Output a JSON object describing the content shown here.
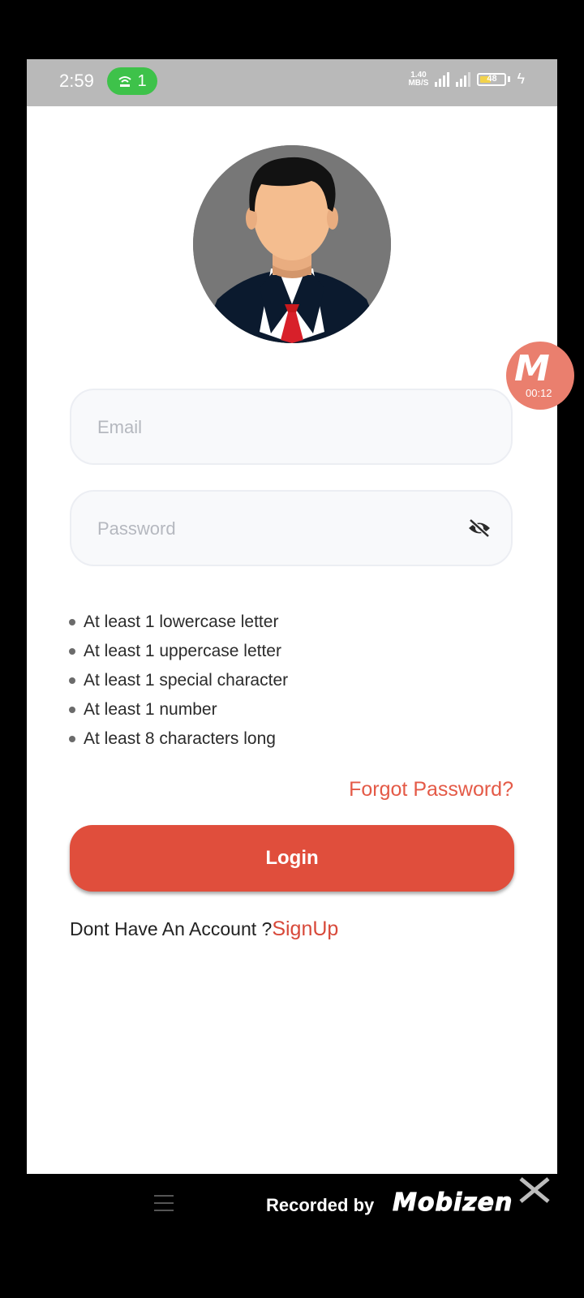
{
  "status_bar": {
    "time": "2:59",
    "hotspot_count": "1",
    "net_speed_value": "1.40",
    "net_speed_unit": "MB/S",
    "battery_level": "48",
    "battery_fraction": 0.48
  },
  "recorder_overlay": {
    "logo_letter": "M",
    "elapsed": "00:12"
  },
  "form": {
    "email_placeholder": "Email",
    "password_placeholder": "Password",
    "password_rules": [
      "At least 1 lowercase letter",
      "At least 1 uppercase letter",
      "At least 1 special character",
      "At least 1 number",
      "At least 8 characters long"
    ],
    "forgot_password_label": "Forgot Password?",
    "login_label": "Login",
    "signup_prompt": "Dont Have An Account ?",
    "signup_link": "SignUp"
  },
  "footer": {
    "recorded_by": "Recorded by",
    "brand": "Mobizen"
  },
  "colors": {
    "accent": "#e04e3c",
    "link": "#e45a47",
    "status_bar": "#b9b9b9",
    "hotspot_pill": "#3ec24a",
    "field_bg": "#f8f9fb"
  },
  "icons": {
    "avatar": "businessman-avatar-icon",
    "password_toggle": "eye-off-icon",
    "hotspot": "hotspot-icon",
    "menu": "menu-icon",
    "close": "close-icon"
  }
}
